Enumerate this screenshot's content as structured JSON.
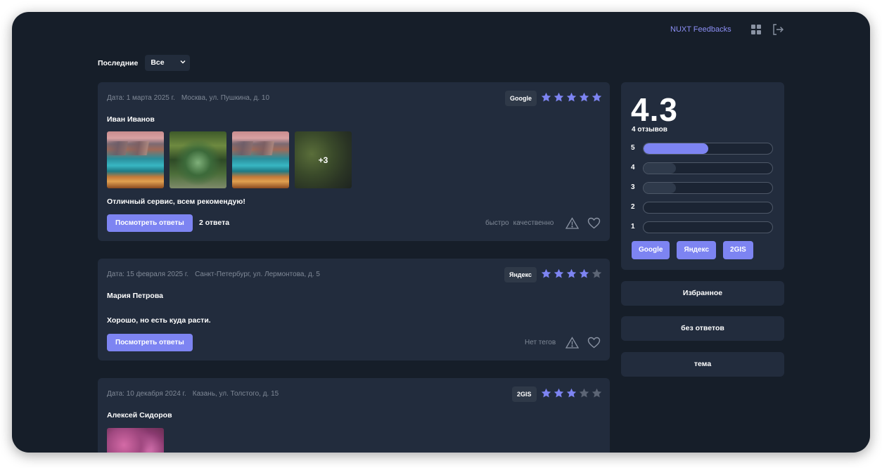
{
  "header": {
    "brand": "NUXT Feedbacks",
    "icons": [
      "grid-icon",
      "logout-icon"
    ]
  },
  "filter": {
    "label": "Последние",
    "selected": "Все"
  },
  "colors": {
    "accent": "#7d84f2",
    "star_active": "#7d84f2",
    "star_inactive": "#5c6575",
    "background": "#161e29",
    "card": "#222c3d"
  },
  "reviews": [
    {
      "date": "Дата: 1 марта 2025 г.",
      "address": "Москва, ул. Пушкина, д. 10",
      "source": "Google",
      "rating": 5,
      "author": "Иван Иванов",
      "more_photos": "+3",
      "text": "Отличный сервис, всем рекомендую!",
      "button": "Посмотреть ответы",
      "answers": "2 ответа",
      "tags": [
        "быстро",
        "качественно"
      ]
    },
    {
      "date": "Дата: 15 февраля 2025 г.",
      "address": "Санкт-Петербург, ул. Лермонтова, д. 5",
      "source": "Яндекс",
      "rating": 4,
      "author": "Мария Петрова",
      "text": "Хорошо, но есть куда расти.",
      "button": "Посмотреть ответы",
      "tags_empty": "Нет тегов"
    },
    {
      "date": "Дата: 10 декабря 2024 г.",
      "address": "Казань, ул. Толстого, д. 15",
      "source": "2GIS",
      "rating": 3,
      "author": "Алексей Сидоров"
    }
  ],
  "summary": {
    "average": "4.3",
    "count": "4 отзывов",
    "distribution": [
      {
        "stars": "5",
        "fraction": 0.5
      },
      {
        "stars": "4",
        "fraction": 0.25
      },
      {
        "stars": "3",
        "fraction": 0.25
      },
      {
        "stars": "2",
        "fraction": 0
      },
      {
        "stars": "1",
        "fraction": 0
      }
    ],
    "sources": [
      "Google",
      "Яндекс",
      "2GIS"
    ]
  },
  "sidebar": {
    "favorites": "Избранное",
    "no_answers": "без ответов",
    "topic": "тема"
  }
}
